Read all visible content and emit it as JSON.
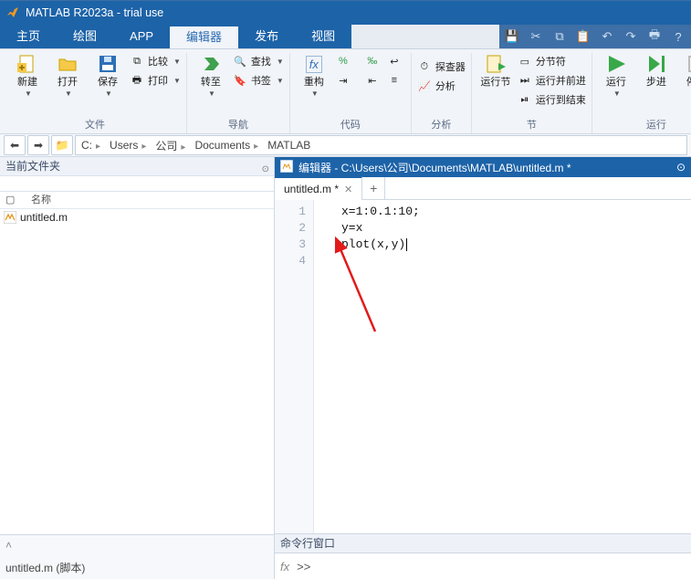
{
  "window": {
    "title": "MATLAB R2023a - trial use"
  },
  "tabs": {
    "items": [
      "主页",
      "绘图",
      "APP",
      "编辑器",
      "发布",
      "视图"
    ],
    "active_index": 3
  },
  "ribbon": {
    "groups": {
      "file": {
        "label": "文件",
        "new": "新建",
        "open": "打开",
        "save": "保存",
        "compare": "比较",
        "print": "打印"
      },
      "nav": {
        "label": "导航",
        "goto": "转至",
        "find": "查找",
        "bookmark": "书签"
      },
      "code": {
        "label": "代码",
        "refactor": "重构"
      },
      "analyze": {
        "label": "分析",
        "profiler": "探查器",
        "analyze": "分析"
      },
      "section": {
        "label": "节",
        "run_section": "运行节",
        "section_break": "分节符",
        "run_advance": "运行并前进",
        "run_to_end": "运行到结束"
      },
      "run": {
        "label": "运行",
        "run": "运行",
        "step": "步进",
        "stop": "停止"
      }
    }
  },
  "addressbar": {
    "root_icon": "📁",
    "crumbs": [
      "C:",
      "Users",
      "公司",
      "Documents",
      "MATLAB"
    ]
  },
  "current_folder": {
    "title": "当前文件夹",
    "col_name": "名称",
    "files": [
      {
        "name": "untitled.m"
      }
    ]
  },
  "detail": {
    "text": "untitled.m  (脚本)"
  },
  "editor_panel": {
    "title": "编辑器 - C:\\Users\\公司\\Documents\\MATLAB\\untitled.m *",
    "tab_label": "untitled.m *",
    "lines": [
      "x=1:0.1:10;",
      "y=x",
      "plot(x,y)",
      ""
    ],
    "line_numbers": [
      "1",
      "2",
      "3",
      "4"
    ]
  },
  "command_window": {
    "title": "命令行窗口",
    "fx": "fx",
    "prompt": ">>"
  }
}
